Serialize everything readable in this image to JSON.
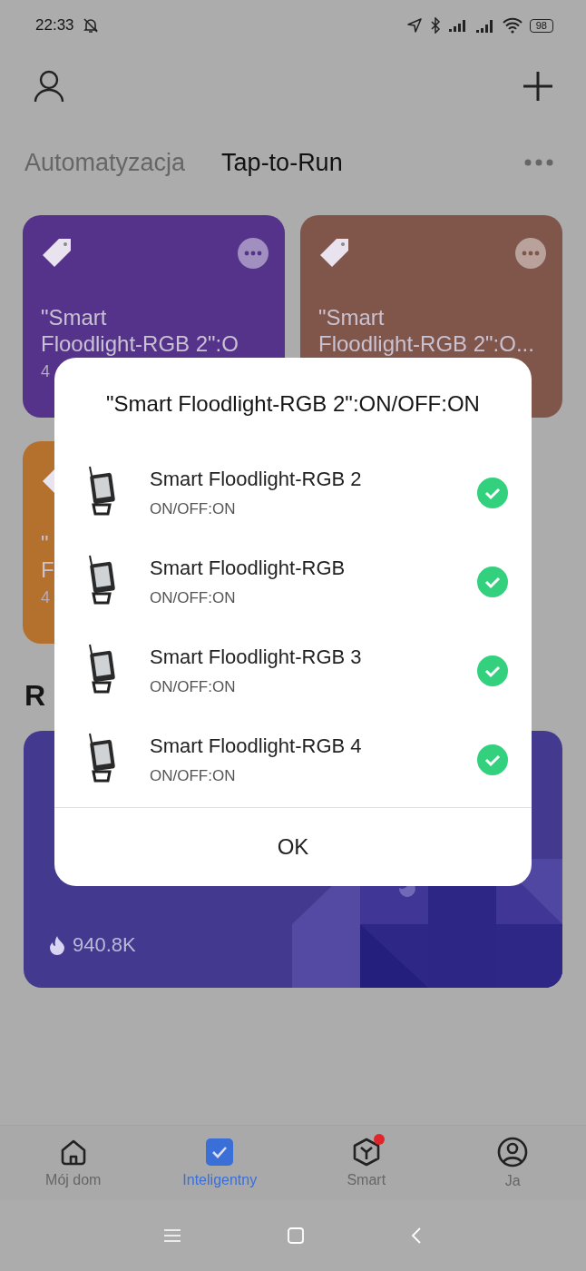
{
  "status_bar": {
    "time": "22:33",
    "battery": "98"
  },
  "tabs": [
    {
      "label": "Automatyzacja",
      "selected": false
    },
    {
      "label": "Tap-to-Run",
      "selected": true
    }
  ],
  "cards": [
    {
      "title_lines": [
        "\"Smart",
        "Floodlight-RGB 2\":O"
      ],
      "count": "4",
      "color": "#55338b",
      "menu": true
    },
    {
      "title_lines": [
        "\"Smart",
        "Floodlight-RGB 2\":O..."
      ],
      "color": "#80564a",
      "menu": true
    },
    {
      "title_lines": [
        "\"",
        "F"
      ],
      "count": "4",
      "color": "#b4702d"
    }
  ],
  "section": {
    "heading": "R",
    "card": {
      "views": "940.8K"
    }
  },
  "dialog": {
    "title": "\"Smart Floodlight-RGB 2\":ON/OFF:ON",
    "devices": [
      {
        "name": "Smart Floodlight-RGB 2",
        "action": "ON/OFF:ON",
        "checked": true
      },
      {
        "name": "Smart Floodlight-RGB",
        "action": "ON/OFF:ON",
        "checked": true
      },
      {
        "name": "Smart Floodlight-RGB 3",
        "action": "ON/OFF:ON",
        "checked": true
      },
      {
        "name": "Smart Floodlight-RGB 4",
        "action": "ON/OFF:ON",
        "checked": true
      }
    ],
    "button": "OK"
  },
  "bottom_nav": [
    {
      "label": "Mój dom",
      "kind": "home",
      "selected": false,
      "has_notification": false
    },
    {
      "label": "Inteligentny",
      "kind": "check",
      "selected": true,
      "has_notification": false
    },
    {
      "label": "Smart",
      "kind": "cube",
      "selected": false,
      "has_notification": true
    },
    {
      "label": "Ja",
      "kind": "person",
      "selected": false,
      "has_notification": false
    }
  ]
}
